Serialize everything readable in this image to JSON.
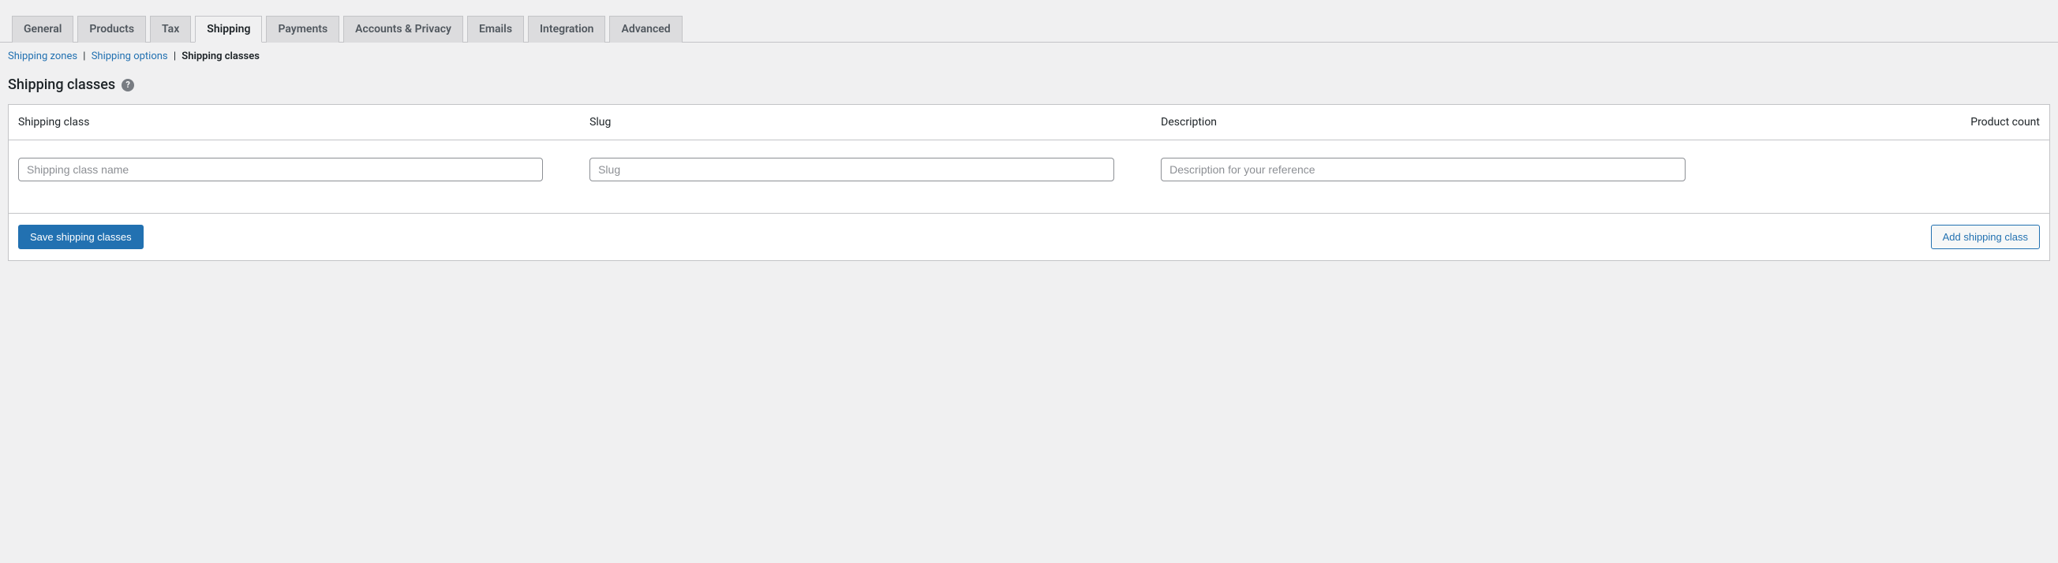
{
  "tabs": {
    "general": "General",
    "products": "Products",
    "tax": "Tax",
    "shipping": "Shipping",
    "payments": "Payments",
    "accounts": "Accounts & Privacy",
    "emails": "Emails",
    "integration": "Integration",
    "advanced": "Advanced"
  },
  "subtabs": {
    "zones": "Shipping zones",
    "options": "Shipping options",
    "classes": "Shipping classes"
  },
  "page": {
    "title": "Shipping classes",
    "help_tooltip": "?"
  },
  "table": {
    "headers": {
      "class": "Shipping class",
      "slug": "Slug",
      "description": "Description",
      "count": "Product count"
    },
    "row": {
      "class_placeholder": "Shipping class name",
      "slug_placeholder": "Slug",
      "description_placeholder": "Description for your reference",
      "class_value": "",
      "slug_value": "",
      "description_value": ""
    }
  },
  "actions": {
    "save": "Save shipping classes",
    "add": "Add shipping class"
  }
}
